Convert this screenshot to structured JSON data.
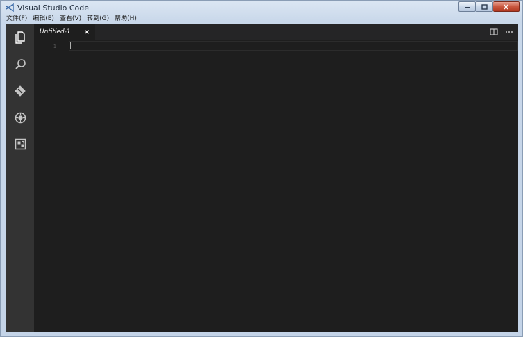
{
  "window": {
    "title": "Visual Studio Code",
    "caption_buttons": [
      "minimize-icon",
      "maximize-icon",
      "close-icon"
    ]
  },
  "menubar": {
    "items": [
      {
        "label": "文件(F)"
      },
      {
        "label": "编辑(E)"
      },
      {
        "label": "查看(V)"
      },
      {
        "label": "转到(G)"
      },
      {
        "label": "帮助(H)"
      }
    ]
  },
  "activity_bar": {
    "items": [
      {
        "icon": "explorer-icon",
        "active": true
      },
      {
        "icon": "search-icon"
      },
      {
        "icon": "git-icon"
      },
      {
        "icon": "debug-icon"
      },
      {
        "icon": "extensions-icon"
      }
    ]
  },
  "editor": {
    "tabs": [
      {
        "label": "Untitled-1",
        "close": "×",
        "active": true
      }
    ],
    "actions": [
      "split-editor-icon",
      "more-actions-icon"
    ],
    "line_numbers": [
      "1"
    ],
    "content": ""
  },
  "colors": {
    "activity_bar": "#333333",
    "editor_background": "#1e1e1e",
    "tab_bar": "#252526",
    "titlebar": "#c9d8ea"
  }
}
